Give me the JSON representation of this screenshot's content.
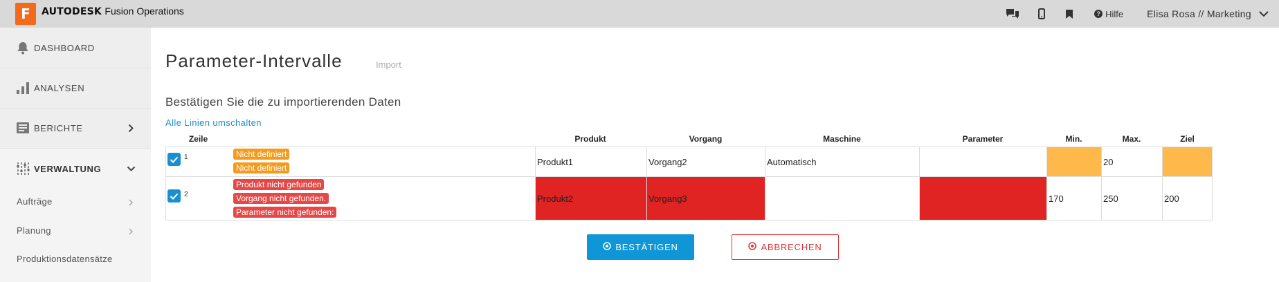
{
  "app": {
    "logo_letter": "F",
    "brand_bold": "AUTODESK",
    "brand_rest": "Fusion Operations",
    "accent": "#f26b1d"
  },
  "topbar": {
    "icons": [
      "chat-icon",
      "mobile-icon",
      "bookmark-icon"
    ],
    "help_label": "Hilfe",
    "user_label": "Elisa Rosa // Marketing"
  },
  "sidebar": {
    "items": [
      {
        "label": "DASHBOARD",
        "icon": "bell-icon"
      },
      {
        "label": "ANALYSEN",
        "icon": "bar-chart-icon"
      },
      {
        "label": "BERICHTE",
        "icon": "report-icon"
      },
      {
        "label": "VERWALTUNG",
        "icon": "sliders-icon"
      }
    ],
    "subitems": [
      {
        "label": "Aufträge"
      },
      {
        "label": "Planung"
      },
      {
        "label": "Produktionsdatensätze"
      }
    ]
  },
  "main": {
    "title": "Parameter-Intervalle",
    "subtitle": "Import",
    "section_title": "Bestätigen Sie die zu importierenden Daten",
    "toggle_all": "Alle Linien umschalten",
    "columns": {
      "row": "Zeile",
      "product": "Produkt",
      "operation": "Vorgang",
      "machine": "Maschine",
      "parameter": "Parameter",
      "min": "Min.",
      "max": "Max.",
      "target": "Ziel"
    },
    "rows": [
      {
        "number": "1",
        "checked": true,
        "messages": [
          "Nicht definiert",
          "Nicht definiert"
        ],
        "product": "Produkt1",
        "operation": "Vorgang2",
        "machine": "Automatisch",
        "parameter": "",
        "min": "",
        "max": "20",
        "target": ""
      },
      {
        "number": "2",
        "checked": true,
        "messages": [
          "Produkt nicht gefunden",
          "Vorgang nicht gefunden.",
          "Parameter nicht gefunden:"
        ],
        "product": "Produkt2",
        "operation": "Vorgang3",
        "machine": "",
        "parameter": "",
        "min": "170",
        "max": "250",
        "target": "200"
      }
    ],
    "confirm_label": "BESTÄTIGEN",
    "cancel_label": "ABBRECHEN",
    "colors": {
      "warning_cell": "#ffb84a",
      "error_cell": "#e02323",
      "primary": "#0e96d6"
    }
  }
}
